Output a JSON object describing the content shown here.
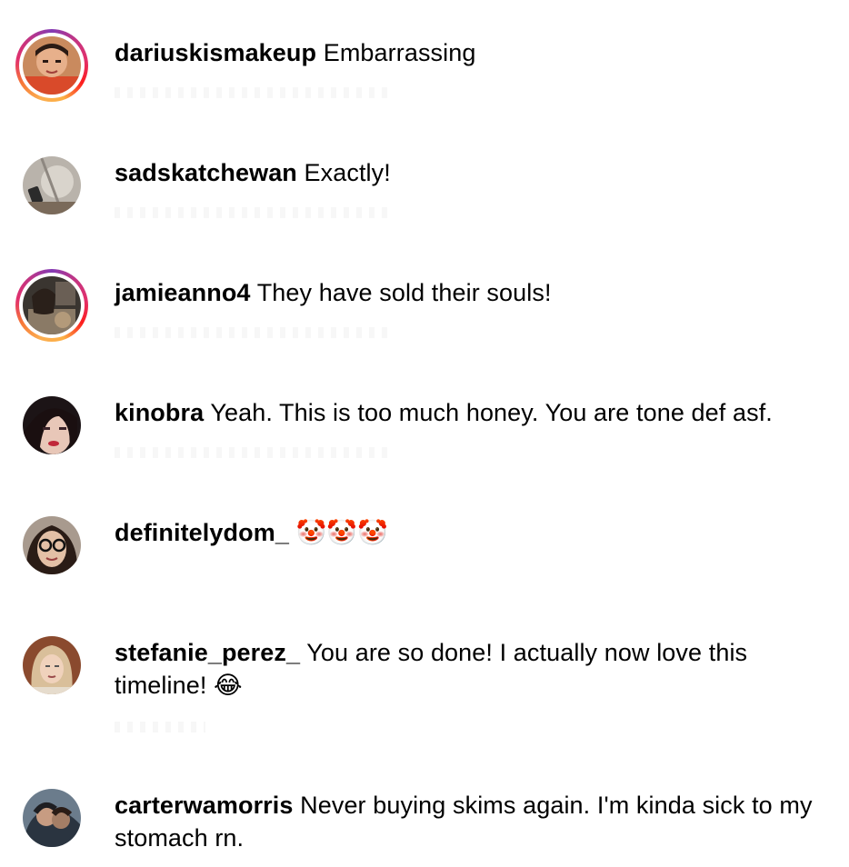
{
  "comments": [
    {
      "username": "dariuskismakeup",
      "text": "Embarrassing",
      "avatar_icon": "user-avatar-icon",
      "has_story": true
    },
    {
      "username": "sadskatchewan",
      "text": "Exactly!",
      "avatar_icon": "user-avatar-icon",
      "has_story": false
    },
    {
      "username": "jamieanno4",
      "text": "They have sold their souls!",
      "avatar_icon": "user-avatar-icon",
      "has_story": true
    },
    {
      "username": "kinobra",
      "text": "Yeah. This is too much honey. You are tone def asf.",
      "avatar_icon": "user-avatar-icon",
      "has_story": false
    },
    {
      "username": "definitelydom_",
      "text": "🤡🤡🤡",
      "avatar_icon": "user-avatar-icon",
      "has_story": false
    },
    {
      "username": "stefanie_perez_",
      "text": "You are so done! I actually now love this timeline! 😂",
      "avatar_icon": "user-avatar-icon",
      "has_story": false
    },
    {
      "username": "carterwamorris",
      "text": "Never buying skims again. I'm kinda sick to my stomach rn.",
      "avatar_icon": "user-avatar-icon",
      "has_story": false
    }
  ],
  "colors": {
    "story_ring_start": "#fbad50",
    "story_ring_end": "#c13584",
    "text": "#000000",
    "background": "#ffffff"
  }
}
